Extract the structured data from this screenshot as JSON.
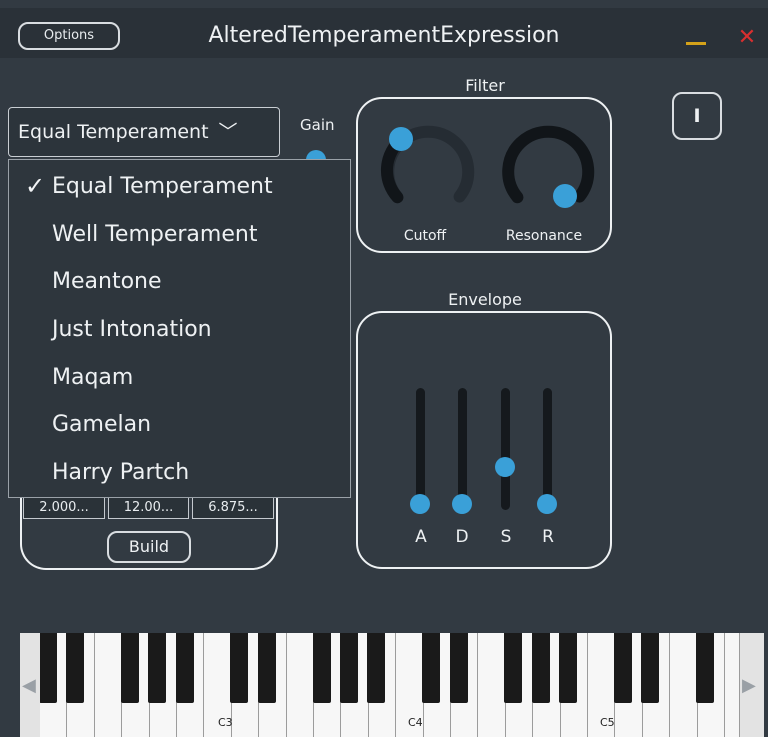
{
  "window": {
    "title": "AlteredTemperamentExpression",
    "options_label": "Options",
    "minimize_glyph": "—",
    "close_glyph": "✕"
  },
  "temperament": {
    "selected": "Equal Temperament",
    "chevron": "﹀",
    "checkmark": "✓",
    "options": [
      "Equal Temperament",
      "Well Temperament",
      "Meantone",
      "Just Intonation",
      "Maqam",
      "Gamelan",
      "Harry Partch"
    ]
  },
  "gain": {
    "label": "Gain"
  },
  "filter": {
    "title": "Filter",
    "cutoff": {
      "label": "Cutoff"
    },
    "resonance": {
      "label": "Resonance"
    }
  },
  "envelope": {
    "title": "Envelope",
    "sliders": [
      {
        "label": "A"
      },
      {
        "label": "D"
      },
      {
        "label": "S"
      },
      {
        "label": "R"
      }
    ]
  },
  "info_button": {
    "label": "I"
  },
  "build": {
    "fields": [
      "2.000...",
      "12.00...",
      "6.875..."
    ],
    "button_label": "Build"
  },
  "keyboard": {
    "note_labels": [
      "C3",
      "C4",
      "C5"
    ],
    "left_arrow": "◀",
    "right_arrow": "▶"
  },
  "colors": {
    "background": "#323a42",
    "accent": "#3aa0d8",
    "close": "#d92f2f",
    "minimize": "#d4a21a"
  }
}
